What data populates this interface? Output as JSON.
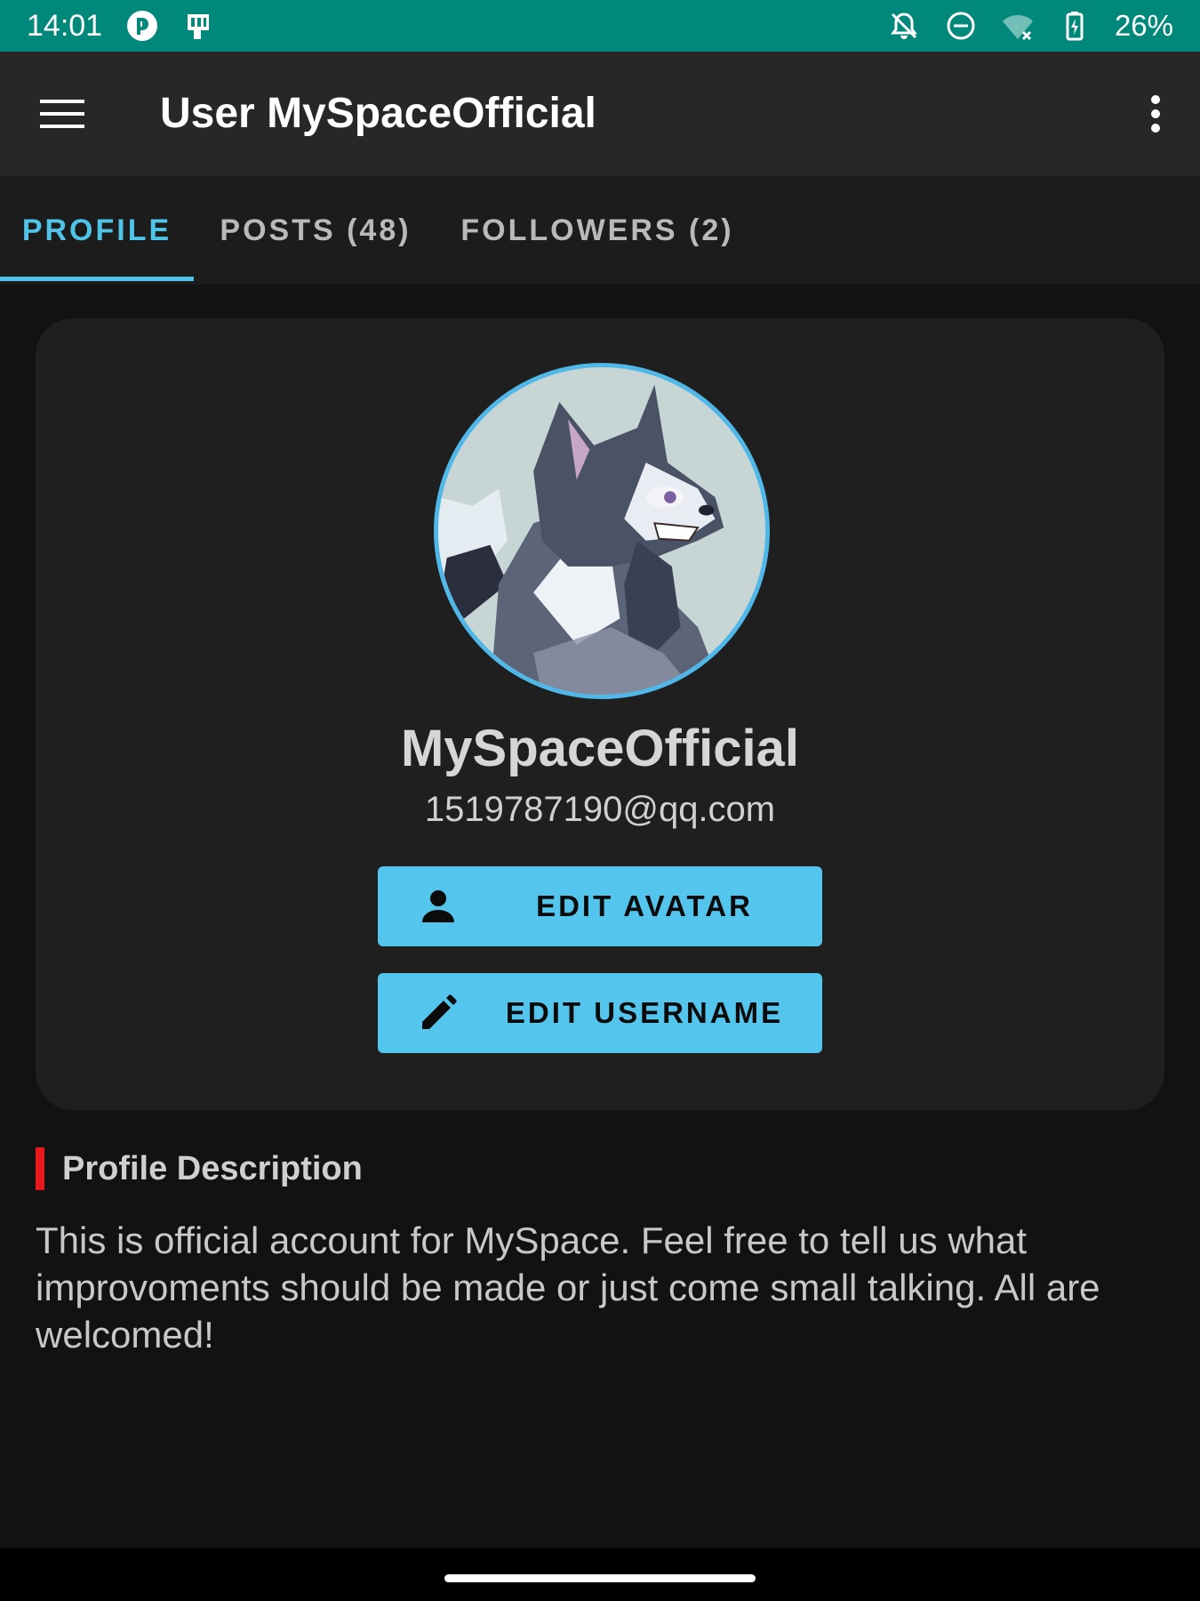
{
  "status_bar": {
    "time": "14:01",
    "battery": "26%",
    "left_icons": [
      "pocket-app-icon",
      "sim-card-icon"
    ],
    "right_icons": [
      "notifications-off-icon",
      "do-not-disturb-icon",
      "wifi-off-icon",
      "battery-charging-icon"
    ],
    "background": "#00897b"
  },
  "app_bar": {
    "title": "User MySpaceOfficial",
    "menu_icon": "hamburger-menu-icon",
    "overflow_icon": "more-vertical-icon"
  },
  "tabs": [
    {
      "label": "PROFILE",
      "active": true
    },
    {
      "label": "POSTS (48)",
      "active": false
    },
    {
      "label": "FOLLOWERS (2)",
      "active": false
    }
  ],
  "profile": {
    "avatar_icon": "wolf-avatar-image",
    "username": "MySpaceOfficial",
    "email": "1519787190@qq.com",
    "buttons": {
      "edit_avatar": "EDIT AVATAR",
      "edit_username": "EDIT USERNAME"
    }
  },
  "description": {
    "heading": "Profile Description",
    "text": "This is official account for MySpace. Feel free to tell us what improvoments should be made or just come small talking. All are welcomed!"
  },
  "colors": {
    "accent": "#4fc3e8",
    "button": "#54c5ec",
    "heading_bar": "#e8191c"
  }
}
